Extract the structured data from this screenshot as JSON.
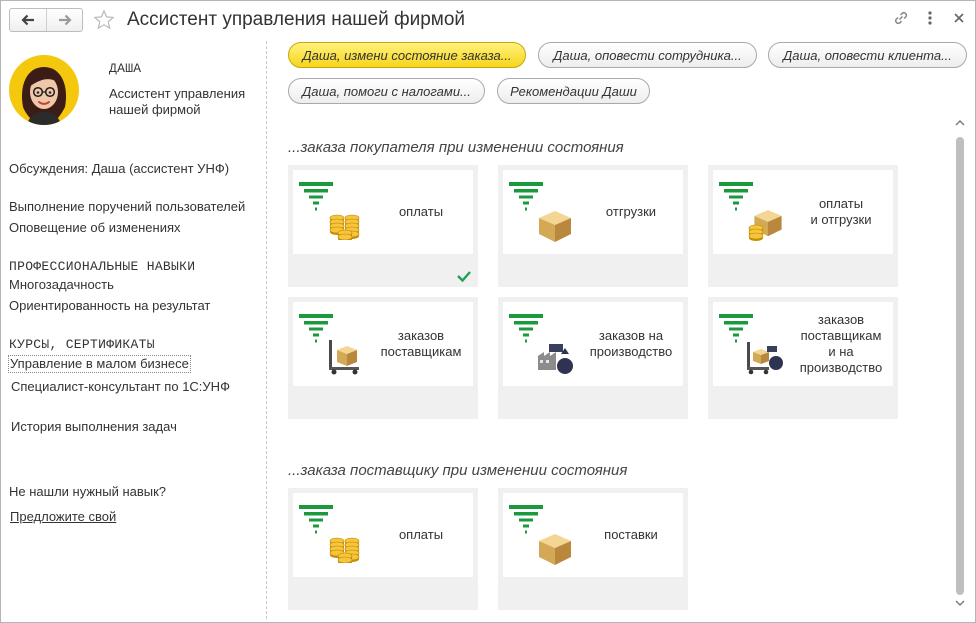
{
  "window": {
    "title": "Ассистент управления нашей фирмой"
  },
  "titlebar_icons": [
    "back-arrow-icon",
    "forward-arrow-icon",
    "favorite-star-icon",
    "link-icon",
    "more-menu-icon",
    "close-icon"
  ],
  "assistant": {
    "name": "ДАША",
    "role": "Ассистент управления\nнашей фирмой",
    "discussion": "Обсуждения: Даша (ассистент УНФ)",
    "duties": [
      "Выполнение поручений пользователей",
      "Оповещение об изменениях"
    ],
    "skills_header": "ПРОФЕССИОНАЛЬНЫЕ НАВЫКИ",
    "skills": [
      "Многозадачность",
      "Ориентированность на результат"
    ],
    "courses_header": "КУРСЫ, СЕРТИФИКАТЫ",
    "courses": [
      "Управление в малом бизнесе",
      "Специалист-консультант по 1С:УНФ"
    ],
    "history_link": "История выполнения задач",
    "no_skill_text": "Не нашли нужный навык?",
    "suggest_link": "Предложите свой"
  },
  "commands": [
    "Даша, измени состояние заказа...",
    "Даша, оповести сотрудника...",
    "Даша, оповести клиента...",
    "Даша, помоги с налогами...",
    "Рекомендации Даши"
  ],
  "sections": [
    {
      "title": "...заказа покупателя при изменении состояния",
      "tiles": [
        {
          "label": "оплаты",
          "icon": "coins-icon",
          "selected": true
        },
        {
          "label": "отгрузки",
          "icon": "box-icon",
          "selected": false
        },
        {
          "label": "оплаты\nи отгрузки",
          "icon": "box-coins-icon",
          "selected": false
        },
        {
          "label": "заказов\nпоставщикам",
          "icon": "pallet-truck-icon",
          "selected": false
        },
        {
          "label": "заказов на\nпроизводство",
          "icon": "factory-icon",
          "selected": false
        },
        {
          "label": "заказов\nпоставщикам\nи на\nпроизводство",
          "icon": "pallet-factory-icon",
          "selected": false
        }
      ]
    },
    {
      "title": "...заказа поставщику при изменении состояния",
      "tiles": [
        {
          "label": "оплаты",
          "icon": "coins-icon",
          "selected": false
        },
        {
          "label": "поставки",
          "icon": "box-icon",
          "selected": false
        }
      ]
    }
  ],
  "colors": {
    "accent_yellow": "#f6d51b",
    "funnel_green": "#1a9a3c",
    "check_green": "#22a05a"
  }
}
